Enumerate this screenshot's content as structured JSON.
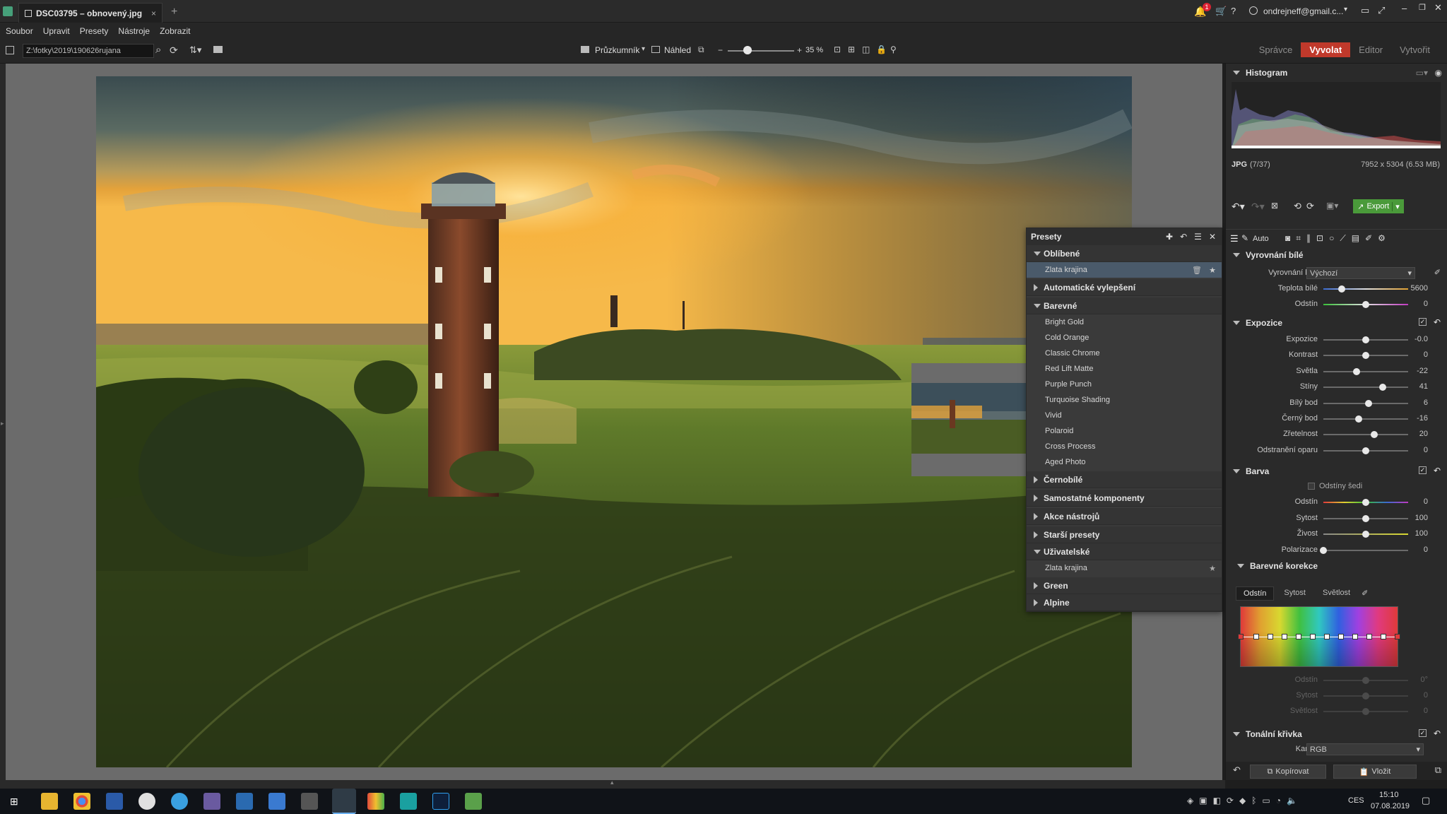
{
  "window": {
    "tab_title": "DSC03795 – obnovený.jpg",
    "new_tab": "+",
    "account": "ondrejneff@gmail.c...",
    "notif_count": "1"
  },
  "menu": [
    "Soubor",
    "Upravit",
    "Presety",
    "Nástroje",
    "Zobrazit"
  ],
  "toolbar": {
    "path": "Z:\\fotky\\2019\\190626rujana",
    "browser_label": "Průzkumník",
    "preview_label": "Náhled",
    "zoom": "35 %",
    "zoom_level": 0.3
  },
  "modes": [
    "Správce",
    "Vyvolat",
    "Editor",
    "Vytvořit"
  ],
  "active_mode": "Vyvolat",
  "histogram": {
    "title": "Histogram",
    "format": "JPG",
    "index": "(7/37)",
    "dimensions": "7952 x 5304 (6.53 MB)"
  },
  "actions": {
    "export": "Export",
    "auto": "Auto",
    "copy": "Kopírovat",
    "paste": "Vložit"
  },
  "white_balance": {
    "title": "Vyrovnání bílé",
    "label": "Vyrovnání bílé",
    "value": "Výchozí",
    "sliders": [
      {
        "label": "Teplota bílé",
        "value": "5600",
        "pos": 0.22
      },
      {
        "label": "Odstín",
        "value": "0",
        "pos": 0.5
      }
    ]
  },
  "exposure": {
    "title": "Expozice",
    "sliders": [
      {
        "label": "Expozice",
        "value": "-0.0",
        "pos": 0.5
      },
      {
        "label": "Kontrast",
        "value": "0",
        "pos": 0.5
      },
      {
        "label": "Světla",
        "value": "-22",
        "pos": 0.39
      },
      {
        "label": "Stíny",
        "value": "41",
        "pos": 0.7
      },
      {
        "label": "Bílý bod",
        "value": "6",
        "pos": 0.53
      },
      {
        "label": "Černý bod",
        "value": "-16",
        "pos": 0.42
      },
      {
        "label": "Zřetelnost",
        "value": "20",
        "pos": 0.6
      },
      {
        "label": "Odstranění oparu",
        "value": "0",
        "pos": 0.5
      }
    ]
  },
  "color": {
    "title": "Barva",
    "grayscale": "Odstíny šedi",
    "sliders": [
      {
        "label": "Odstín",
        "value": "0",
        "pos": 0.5
      },
      {
        "label": "Sytost",
        "value": "100",
        "pos": 0.5
      },
      {
        "label": "Živost",
        "value": "100",
        "pos": 0.5
      },
      {
        "label": "Polarizace",
        "value": "0",
        "pos": 0.0
      }
    ]
  },
  "color_correction": {
    "title": "Barevné korekce",
    "tabs": [
      "Odstín",
      "Sytost",
      "Světlost"
    ],
    "disabled": [
      {
        "label": "Odstín",
        "value": "0°"
      },
      {
        "label": "Sytost",
        "value": "0"
      },
      {
        "label": "Světlost",
        "value": "0"
      }
    ]
  },
  "tone_curve": {
    "title": "Tonální křivka",
    "channel_label": "Kanál:",
    "channel": "RGB"
  },
  "presets": {
    "title": "Presety",
    "favorites": {
      "label": "Oblíbené",
      "items": [
        "Zlata krajina"
      ]
    },
    "auto": "Automatické vylepšení",
    "color": {
      "label": "Barevné",
      "items": [
        "Bright Gold",
        "Cold Orange",
        "Classic Chrome",
        "Red Lift Matte",
        "Purple Punch",
        "Turquoise Shading",
        "Vivid",
        "Polaroid",
        "Cross Process",
        "Aged Photo"
      ]
    },
    "bw": "Černobílé",
    "components": "Samostatné komponenty",
    "tool_actions": "Akce nástrojů",
    "older": "Starší presety",
    "user": {
      "label": "Uživatelské",
      "items": [
        "Zlata krajina"
      ]
    },
    "green": "Green",
    "alpine": "Alpine"
  },
  "taskbar": {
    "lang": "CES",
    "time": "15:10",
    "date": "07.08.2019"
  },
  "colors": {
    "accent": "#c0392b",
    "export": "#4a9a3a"
  }
}
